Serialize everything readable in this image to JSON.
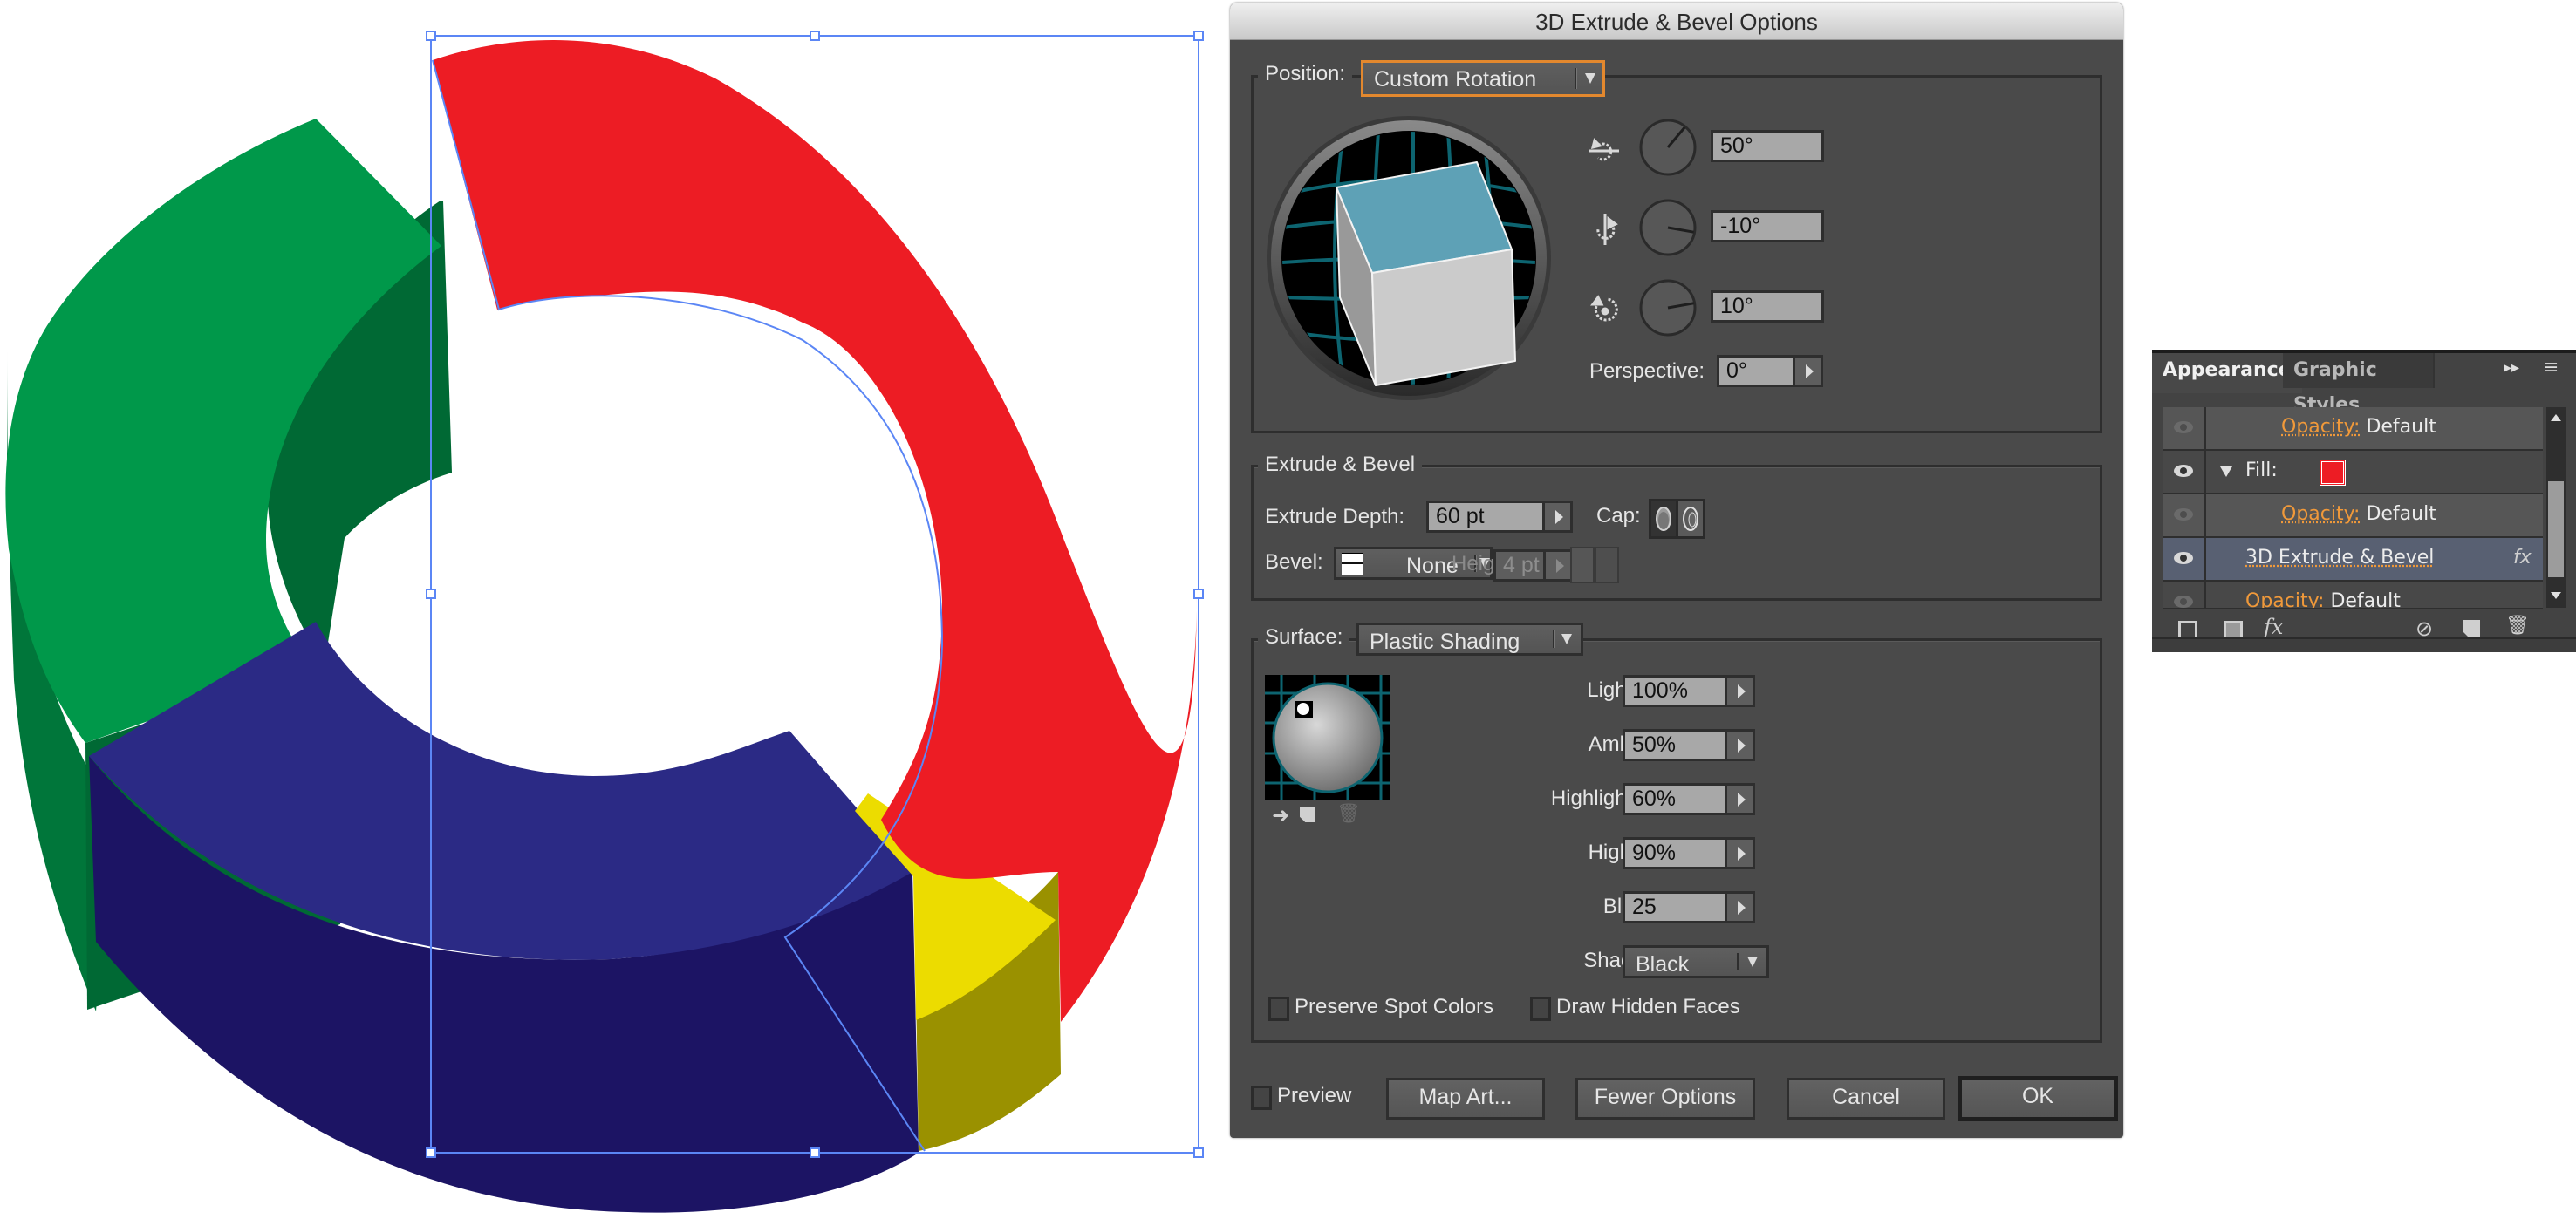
{
  "artwork": {
    "segments": [
      {
        "name": "red",
        "top_color": "#ed1c24"
      },
      {
        "name": "green",
        "top_color": "#00984a",
        "side_color": "#006934"
      },
      {
        "name": "blue",
        "top_color": "#2b2a85",
        "side_color": "#170f5c"
      },
      {
        "name": "yellow",
        "top_color": "#ecdc00",
        "side_color": "#9a9100"
      }
    ],
    "selection_color": "#5b86f5"
  },
  "dialog": {
    "title": "3D Extrude & Bevel Options",
    "position": {
      "label": "Position:",
      "value": "Custom Rotation",
      "rotation_x": "50°",
      "rotation_y": "-10°",
      "rotation_z": "10°",
      "rotation_x_deg": 50,
      "rotation_y_deg": -10,
      "rotation_z_deg": 10,
      "perspective_label": "Perspective:",
      "perspective": "0°"
    },
    "extrude": {
      "title": "Extrude & Bevel",
      "depth_label": "Extrude Depth:",
      "depth": "60 pt",
      "cap_label": "Cap:",
      "bevel_label": "Bevel:",
      "bevel": "None",
      "height_label": "Height:",
      "height": "4 pt"
    },
    "surface": {
      "label": "Surface:",
      "value": "Plastic Shading",
      "light_intensity_label": "Light Intensity:",
      "light_intensity": "100%",
      "ambient_label": "Ambient Light:",
      "ambient": "50%",
      "highlight_intensity_label": "Highlight Intensity:",
      "highlight_intensity": "60%",
      "highlight_size_label": "Highlight Size:",
      "highlight_size": "90%",
      "blend_steps_label": "Blend Steps:",
      "blend_steps": "25",
      "shading_color_label": "Shading Color:",
      "shading_color": "Black",
      "preserve_spot": "Preserve Spot Colors",
      "draw_hidden": "Draw Hidden Faces"
    },
    "footer": {
      "preview": "Preview",
      "map_art": "Map Art...",
      "fewer_options": "Fewer Options",
      "cancel": "Cancel",
      "ok": "OK"
    }
  },
  "appearance": {
    "tabs": [
      "Appearance",
      "Graphic Styles"
    ],
    "rows": [
      {
        "key": "Opacity:",
        "value": "Default"
      },
      {
        "key": "Fill:",
        "swatch": "#ed1c24"
      },
      {
        "key": "Opacity:",
        "value": "Default"
      },
      {
        "key": "3D Extrude & Bevel",
        "fx": "fx"
      },
      {
        "key": "Opacity:",
        "value": "Default"
      }
    ],
    "footer_fx": "fx"
  }
}
